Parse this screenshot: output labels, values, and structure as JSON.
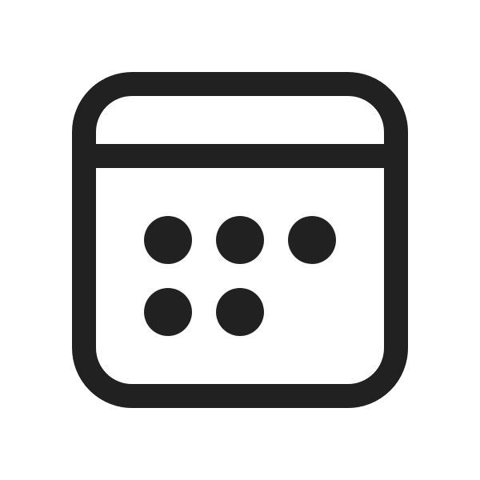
{
  "icon": {
    "name": "calendar-icon",
    "stroke_color": "#212121",
    "fill_color": "#212121",
    "background_color": "#ffffff",
    "day_dots": {
      "row_1": 3,
      "row_2": 2
    }
  }
}
